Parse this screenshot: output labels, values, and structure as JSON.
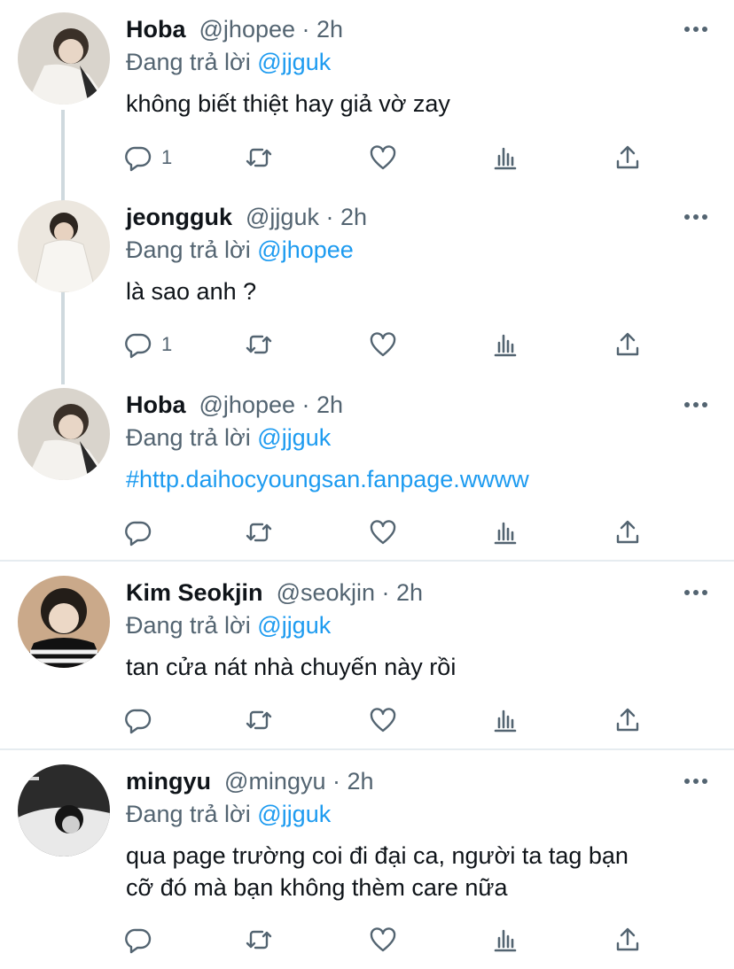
{
  "tweets": [
    {
      "name": "Hoba",
      "handle": "@jhopee · 2h",
      "reply_prefix": "Đang trả lời",
      "reply_handle": "@jjguk",
      "text": "không biết thiệt hay giả vờ zay",
      "reply_count": "1",
      "avatar_color": "#d9d4cc"
    },
    {
      "name": "jeongguk",
      "handle": "@jjguk · 2h",
      "reply_prefix": "Đang trả lời",
      "reply_handle": "@jhopee",
      "text": "là sao anh ?",
      "reply_count": "1",
      "avatar_color": "#ece7df"
    },
    {
      "name": "Hoba",
      "handle": "@jhopee · 2h",
      "reply_prefix": "Đang trả lời",
      "reply_handle": "@jjguk",
      "text": "#http.daihocyoungsan.fanpage.wwww",
      "reply_count": "",
      "avatar_color": "#d9d4cc"
    },
    {
      "name": "Kim Seokjin",
      "handle": "@seokjin · 2h",
      "reply_prefix": "Đang trả lời",
      "reply_handle": "@jjguk",
      "text": "tan cửa nát nhà chuyến này rồi",
      "reply_count": "",
      "avatar_color": "#caa98a"
    },
    {
      "name": "mingyu",
      "handle": "@mingyu · 2h",
      "reply_prefix": "Đang trả lời",
      "reply_handle": "@jjguk",
      "text_line1": "qua page trường coi đi đại ca, người ta tag bạn",
      "text_line2": "cỡ đó mà bạn không thèm care nữa",
      "reply_count": "",
      "avatar_color": "#2b2b2b"
    }
  ],
  "colors": {
    "accent": "#1d9bf0",
    "muted": "#536471",
    "text": "#0f1419",
    "thread_line": "#cfd9de",
    "divider": "#e6ecf0"
  },
  "icons": [
    "reply-icon",
    "retweet-icon",
    "like-icon",
    "analytics-icon",
    "share-icon",
    "more-options-icon"
  ]
}
